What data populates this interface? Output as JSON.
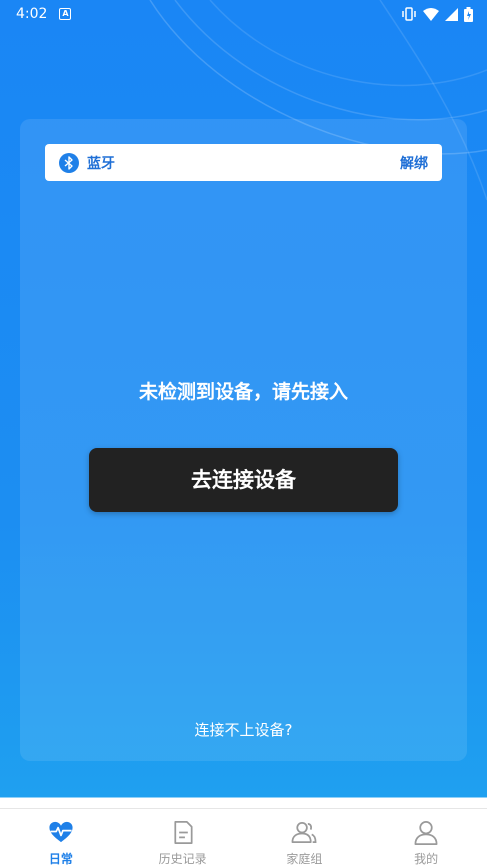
{
  "status_bar": {
    "time": "4:02",
    "app_icon_letter": "A"
  },
  "bluetooth": {
    "label": "蓝牙",
    "unbind_label": "解绑"
  },
  "main": {
    "message": "未检测到设备，请先接入",
    "connect_button_label": "去连接设备",
    "help_link": "连接不上设备?"
  },
  "bottom_nav": {
    "items": [
      {
        "label": "日常",
        "icon": "heartbeat-icon",
        "active": true
      },
      {
        "label": "历史记录",
        "icon": "document-icon",
        "active": false
      },
      {
        "label": "家庭组",
        "icon": "group-icon",
        "active": false
      },
      {
        "label": "我的",
        "icon": "person-icon",
        "active": false
      }
    ]
  },
  "colors": {
    "background": "#1a86f5",
    "accent": "#1f80e8",
    "button": "#222222"
  }
}
